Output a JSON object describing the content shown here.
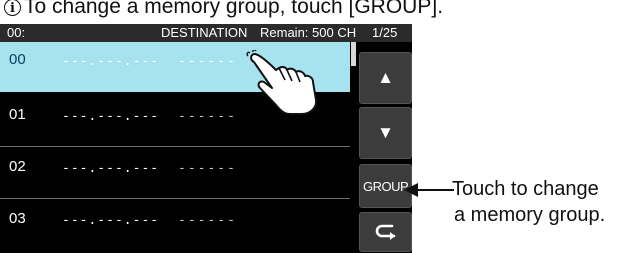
{
  "caption": {
    "icon": "info-icon",
    "text": "To change a memory group, touch [GROUP]."
  },
  "topbar": {
    "channel": "00:",
    "title": "DESTINATION",
    "remain": "Remain: 500 CH",
    "page": "1/25"
  },
  "rows": [
    {
      "ch": "00",
      "freq": "---.---.---",
      "name": "------",
      "selected": true
    },
    {
      "ch": "01",
      "freq": "---.---.---",
      "name": "------",
      "selected": false
    },
    {
      "ch": "02",
      "freq": "---.---.---",
      "name": "------",
      "selected": false
    },
    {
      "ch": "03",
      "freq": "---.---.---",
      "name": "------",
      "selected": false
    }
  ],
  "buttons": {
    "up": "▲",
    "down": "▼",
    "group": "GROUP",
    "back": "⮌"
  },
  "callout": {
    "line1": "Touch to change",
    "line2": "a memory group."
  },
  "colors": {
    "selected_row": "#a6e3ee",
    "screen_bg": "#000000",
    "button_bg": "#3c3c3c"
  }
}
